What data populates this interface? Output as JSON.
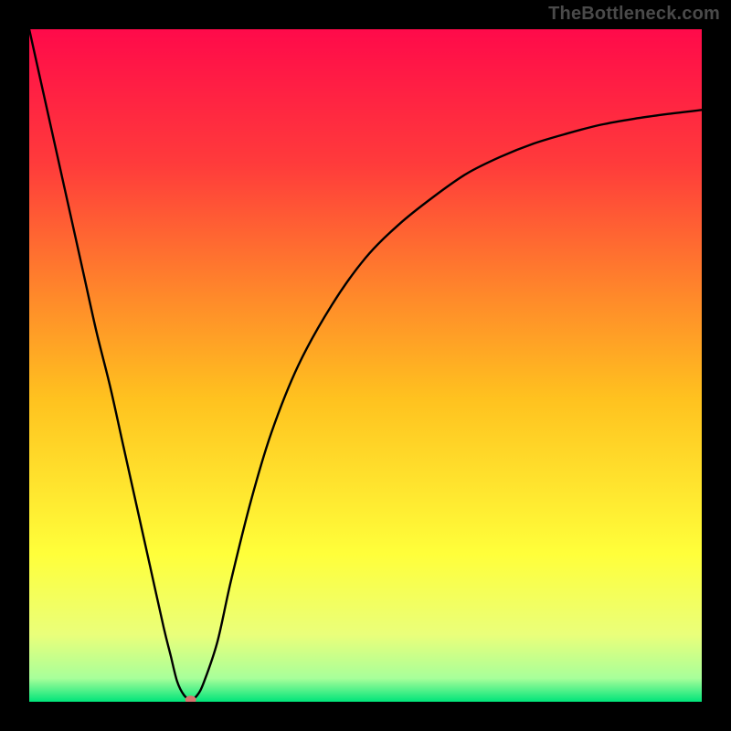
{
  "watermark": "TheBottleneck.com",
  "chart_data": {
    "type": "line",
    "title": "",
    "xlabel": "",
    "ylabel": "",
    "xlim": [
      0,
      100
    ],
    "ylim": [
      0,
      100
    ],
    "grid": false,
    "legend": false,
    "background_gradient": {
      "direction": "top-to-bottom",
      "stops": [
        {
          "pos": 0.0,
          "color": "#ff0a4a"
        },
        {
          "pos": 0.2,
          "color": "#ff3b3b"
        },
        {
          "pos": 0.4,
          "color": "#ff8a2a"
        },
        {
          "pos": 0.55,
          "color": "#ffc21f"
        },
        {
          "pos": 0.78,
          "color": "#ffff3a"
        },
        {
          "pos": 0.9,
          "color": "#eaff7a"
        },
        {
          "pos": 0.965,
          "color": "#a8ff9a"
        },
        {
          "pos": 1.0,
          "color": "#00e47a"
        }
      ]
    },
    "series": [
      {
        "name": "bottleneck-curve",
        "color": "#000000",
        "x": [
          0,
          2,
          4,
          6,
          8,
          10,
          12,
          14,
          16,
          18,
          20,
          21,
          22,
          23,
          24,
          25,
          26,
          28,
          30,
          33,
          36,
          40,
          45,
          50,
          55,
          60,
          65,
          70,
          75,
          80,
          85,
          90,
          95,
          100
        ],
        "y": [
          100,
          91,
          82,
          73,
          64,
          55,
          47,
          38,
          29,
          20,
          11,
          7,
          3,
          1,
          0.3,
          1,
          3,
          9,
          18,
          30,
          40,
          50,
          59,
          66,
          71,
          75,
          78.5,
          81,
          83,
          84.5,
          85.8,
          86.7,
          87.4,
          88
        ]
      }
    ],
    "marker": {
      "x": 24,
      "y": 0.3,
      "color": "#d7736e",
      "radius_px": 5
    }
  }
}
